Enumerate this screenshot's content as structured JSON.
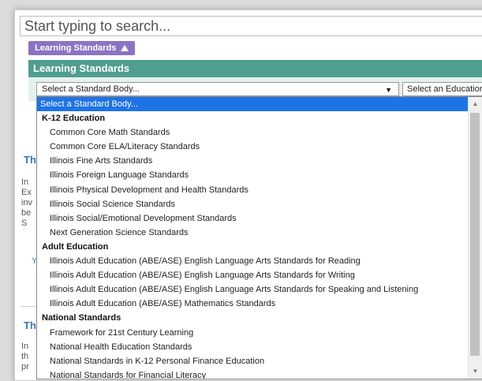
{
  "search": {
    "placeholder": "Start typing to search..."
  },
  "filter_tag": {
    "label": "Learning Standards"
  },
  "section": {
    "title": "Learning Standards"
  },
  "standard_select": {
    "value": "Select a Standard Body..."
  },
  "education_select": {
    "value": "Select an Education Level..."
  },
  "background": {
    "title1": "Th",
    "title2": "Th",
    "lines1": [
      "In",
      "Ex",
      "inv",
      "be",
      "S"
    ],
    "link1": "Y",
    "lines2": [
      "In",
      "th",
      "pr"
    ]
  },
  "dropdown": {
    "items": [
      {
        "label": "Select a Standard Body...",
        "kind": "selected"
      },
      {
        "label": "K-12 Education",
        "kind": "group"
      },
      {
        "label": "Common Core Math Standards",
        "kind": "option"
      },
      {
        "label": "Common Core ELA/Literacy Standards",
        "kind": "option"
      },
      {
        "label": "Illinois Fine Arts Standards",
        "kind": "option"
      },
      {
        "label": "Illinois Foreign Language Standards",
        "kind": "option"
      },
      {
        "label": "Illinois Physical Development and Health Standards",
        "kind": "option"
      },
      {
        "label": "Illinois Social Science Standards",
        "kind": "option"
      },
      {
        "label": "Illinois Social/Emotional Development Standards",
        "kind": "option"
      },
      {
        "label": "Next Generation Science Standards",
        "kind": "option"
      },
      {
        "label": "Adult Education",
        "kind": "group"
      },
      {
        "label": "Illinois Adult Education (ABE/ASE) English Language Arts Standards for Reading",
        "kind": "option"
      },
      {
        "label": "Illinois Adult Education (ABE/ASE) English Language Arts Standards for Writing",
        "kind": "option"
      },
      {
        "label": "Illinois Adult Education (ABE/ASE) English Language Arts Standards for Speaking and Listening",
        "kind": "option"
      },
      {
        "label": "Illinois Adult Education (ABE/ASE) Mathematics Standards",
        "kind": "option"
      },
      {
        "label": "National Standards",
        "kind": "group"
      },
      {
        "label": "Framework for 21st Century Learning",
        "kind": "option"
      },
      {
        "label": "National Health Education Standards",
        "kind": "option"
      },
      {
        "label": "National Standards in K-12 Personal Finance Education",
        "kind": "option"
      },
      {
        "label": "National Standards for Financial Literacy",
        "kind": "option"
      }
    ]
  },
  "colors": {
    "tag": "#8b74c3",
    "header": "#4f9e90",
    "selected": "#1e73e6",
    "link": "#3a77b6"
  },
  "icons": {
    "tag_toggle": "triangle-up-icon",
    "select_arrow": "triangle-down-icon",
    "scroll_up": "chevron-up-icon",
    "scroll_down": "chevron-down-icon"
  }
}
